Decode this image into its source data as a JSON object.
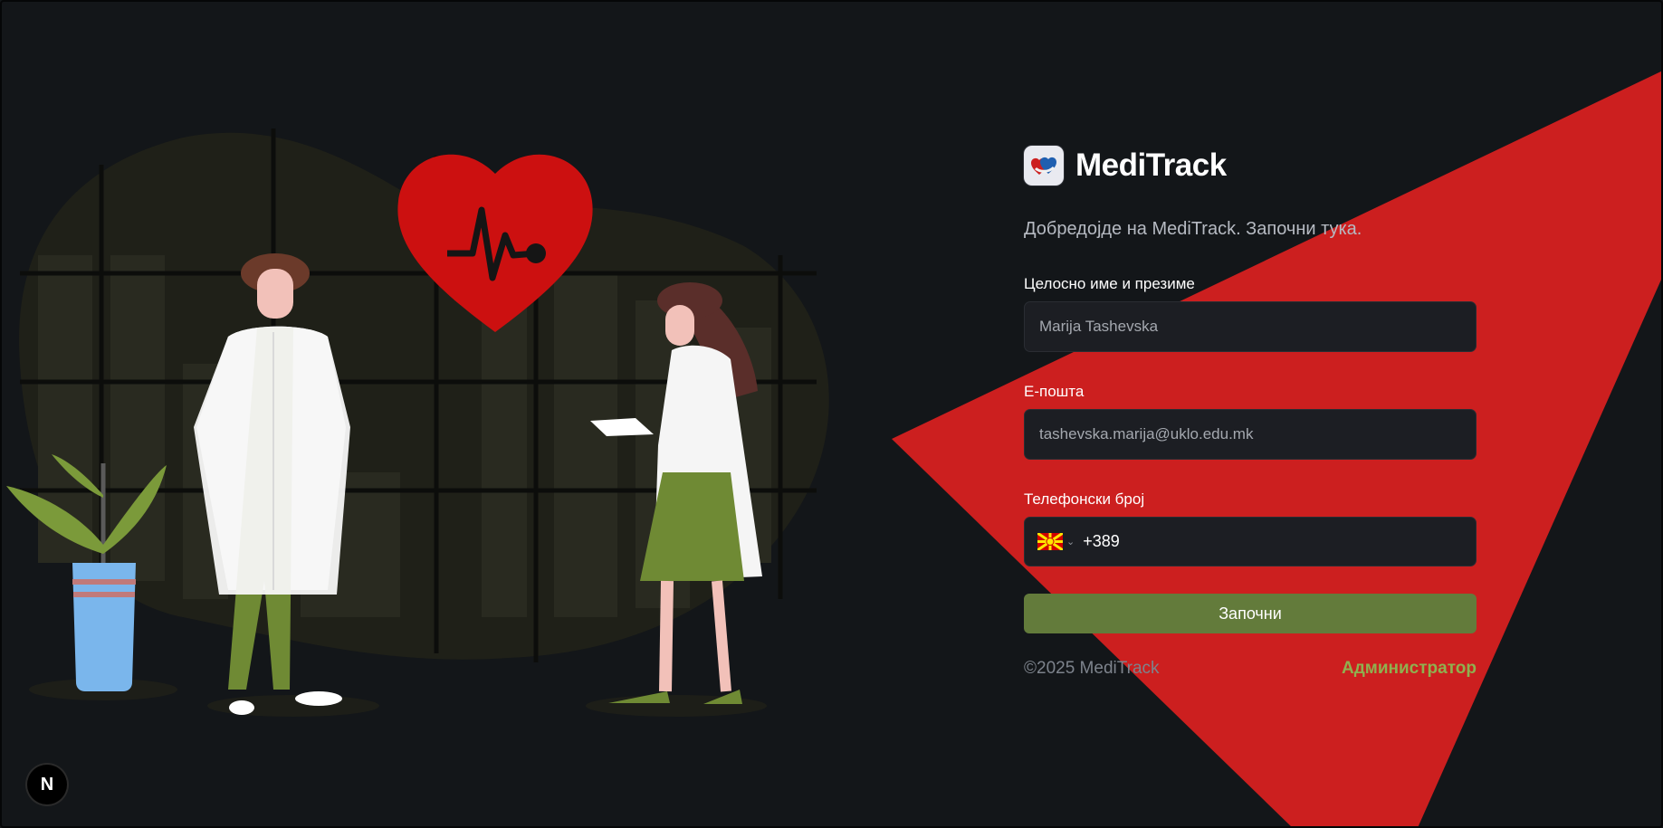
{
  "brand": {
    "name": "MediTrack"
  },
  "welcome": "Добредојде на MediTrack. Започни тука.",
  "fields": {
    "name": {
      "label": "Целосно име и презиме",
      "value": "Marija Tashevska"
    },
    "email": {
      "label": "Е-пошта",
      "value": "tashevska.marija@uklo.edu.mk"
    },
    "phone": {
      "label": "Телефонски број",
      "country": "MK",
      "dial_code": "+389"
    }
  },
  "submit_label": "Започни",
  "footer": {
    "copyright": "©2025 MediTrack",
    "admin_link": "Администратор"
  },
  "dev_badge": "N",
  "colors": {
    "accent_red": "#cc1f1f",
    "button_green": "#637b3b",
    "admin_green": "#8fb04f",
    "background": "#131619"
  },
  "icons": {
    "logo": "heart-hands-logo-icon",
    "flag": "macedonia-flag-icon",
    "chevron": "chevron-down-icon"
  }
}
